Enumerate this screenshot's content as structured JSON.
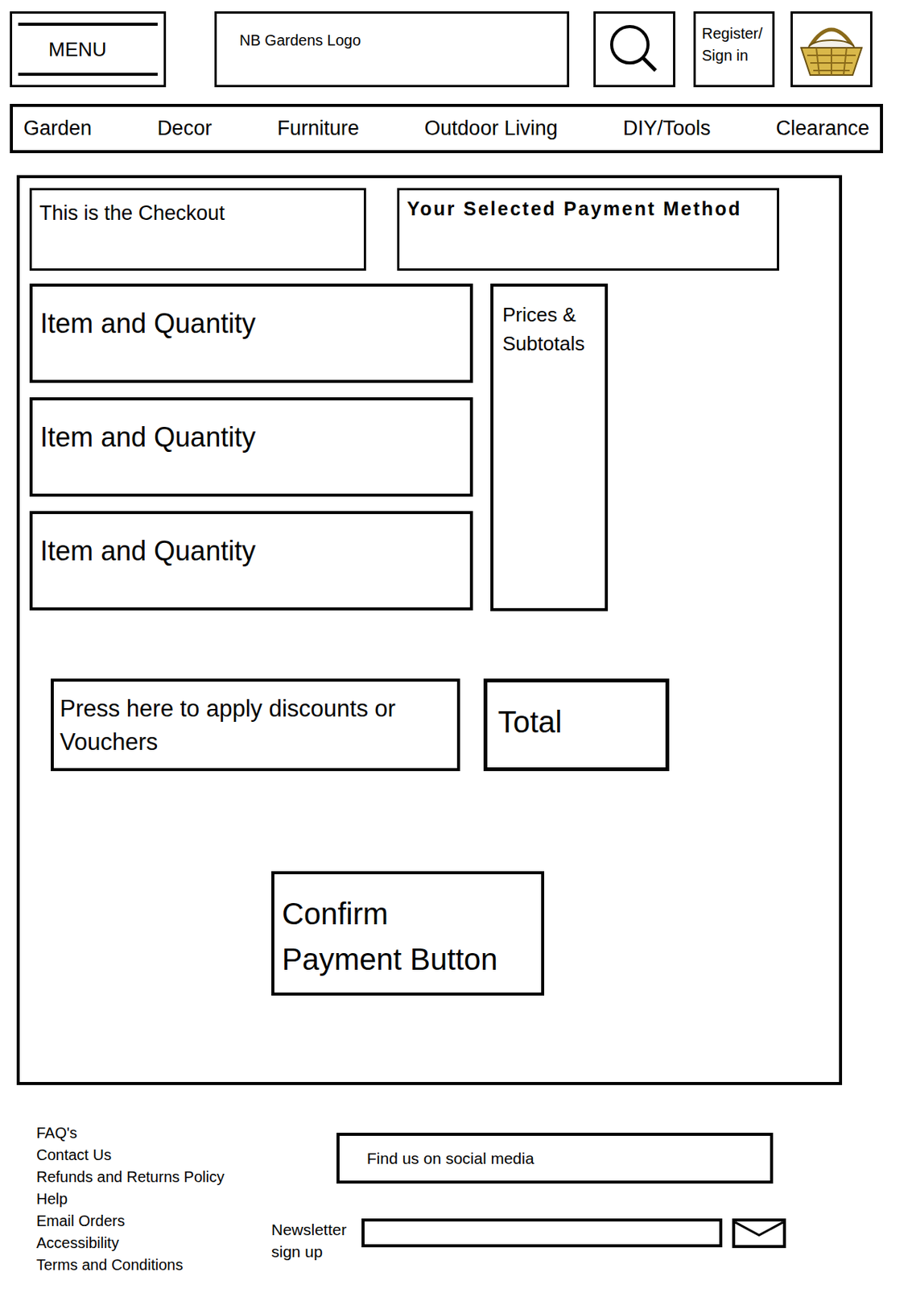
{
  "header": {
    "menu": "MENU",
    "logo": "NB Gardens Logo",
    "account": "Register/ Sign in"
  },
  "nav": [
    "Garden",
    "Decor",
    "Furniture",
    "Outdoor Living",
    "DIY/Tools",
    "Clearance"
  ],
  "checkout": {
    "title": "This is the Checkout",
    "payment_method": "Your Selected Payment Method",
    "items": [
      "Item and Quantity",
      "Item and Quantity",
      "Item and Quantity"
    ],
    "prices": "Prices & Subtotals",
    "discounts": "Press here to apply discounts or Vouchers",
    "total": "Total",
    "confirm": "Confirm Payment Button"
  },
  "footer": {
    "links": [
      "FAQ's",
      "Contact Us",
      "Refunds and Returns Policy",
      "Help",
      "Email Orders",
      "Accessibility",
      "Terms and Conditions"
    ],
    "social": "Find us on social media",
    "newsletter": "Newsletter sign up"
  }
}
